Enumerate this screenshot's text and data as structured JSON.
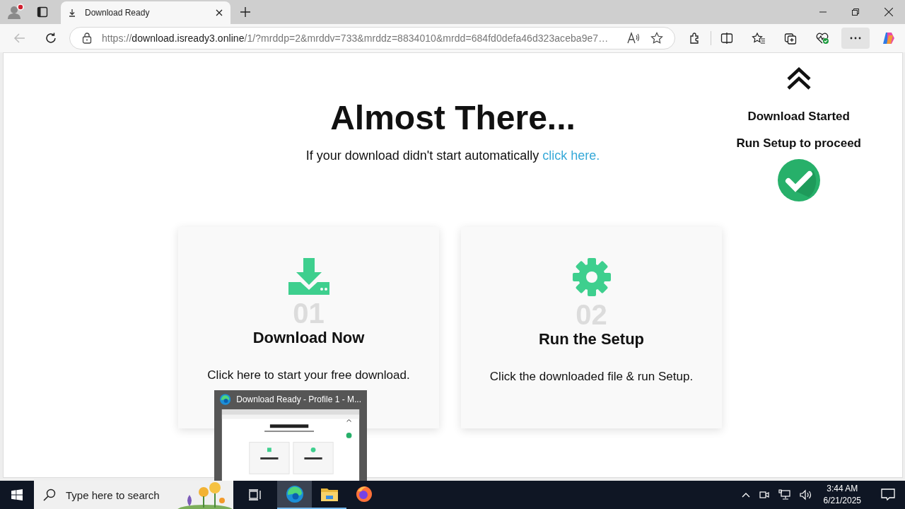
{
  "browser": {
    "tabs": [
      {
        "title": "Download Ready",
        "selected": true
      }
    ],
    "address": {
      "scheme": "https://",
      "domain": "download.isready3.online",
      "path": "/1/?mrddp=2&mrddv=733&mrddz=8834010&mrdd=684fd0defa46d323aceba9e7…"
    }
  },
  "page": {
    "heading": "Almost There...",
    "subheading": "If your download didn't start automatically",
    "link": "click here.",
    "cards": [
      {
        "kind": "download",
        "number": "01",
        "title": "Download Now",
        "text": "Click here to start your free download."
      },
      {
        "kind": "setup",
        "number": "02",
        "title": "Run the Setup",
        "text": "Click the downloaded file & run Setup."
      }
    ],
    "notice": {
      "lines": [
        "Download Started",
        "Run Setup to proceed"
      ]
    }
  },
  "taskbar": {
    "search_placeholder": "Type here to search",
    "apps": [
      {
        "kind": "edge",
        "selected": true,
        "running": true
      },
      {
        "kind": "explorer",
        "selected": false,
        "running": true
      },
      {
        "kind": "firefox",
        "selected": false,
        "running": false
      }
    ],
    "time": "3:44 AM",
    "date": "6/21/2025",
    "preview": {
      "title": "Download Ready - Profile 1 - M..."
    }
  }
}
